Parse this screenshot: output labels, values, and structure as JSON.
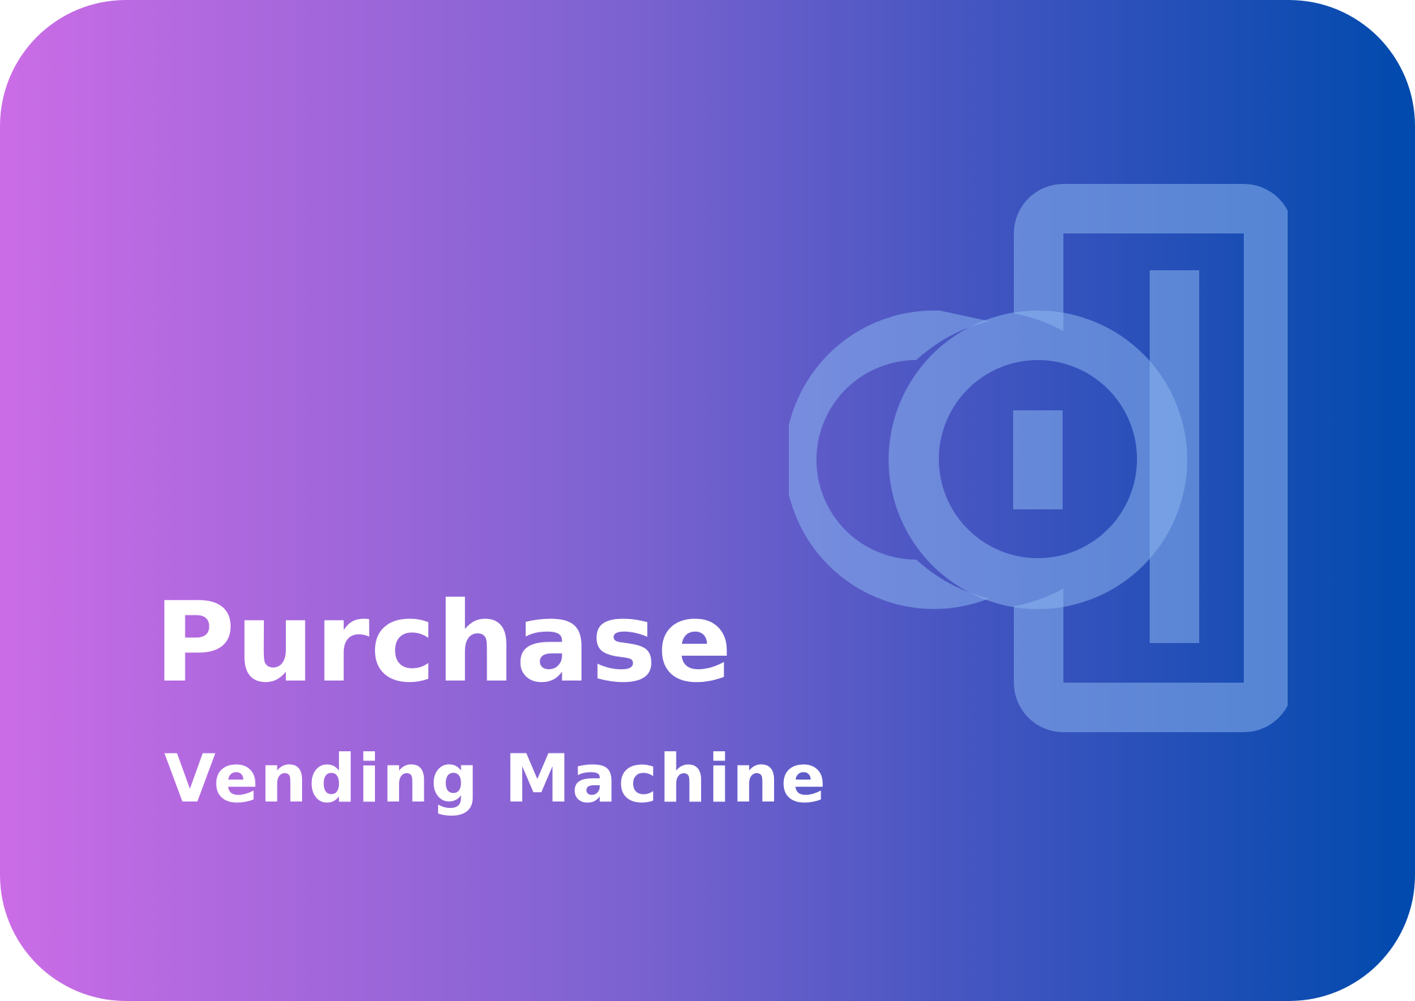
{
  "card": {
    "title": "Purchase",
    "subtitle": "Vending Machine",
    "icon": "coin-insert-vending-icon",
    "colors": {
      "gradient_start": "#cb6ce6",
      "gradient_end": "#004aad",
      "icon": "#8ab4ee",
      "text": "#ffffff"
    }
  }
}
